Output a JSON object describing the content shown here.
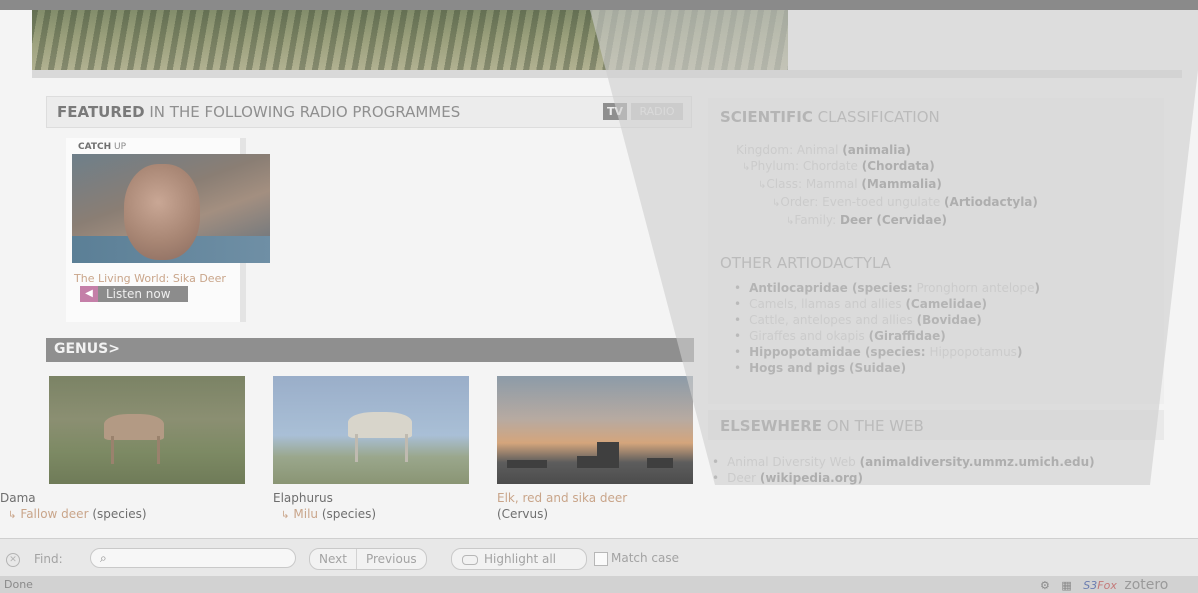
{
  "featured": {
    "title_bold": "FEATURED",
    "title_rest": " IN THE FOLLOWING RADIO PROGRAMMES",
    "tv_tab": "TV",
    "radio_tab": "RADIO"
  },
  "catchup": {
    "label_bold": "CATCH",
    "label_rest": " UP",
    "programme_title": "The Living World: Sika Deer",
    "listen_label": "Listen now"
  },
  "genus": {
    "title": "GENUS>",
    "items": [
      {
        "name": "Dama",
        "link": "Fallow deer",
        "suffix": "(species)"
      },
      {
        "name": "Elaphurus",
        "link": "Milu",
        "suffix": "(species)"
      },
      {
        "name": "Elk, red and sika deer",
        "suffix": "(Cervus)"
      }
    ]
  },
  "classification": {
    "title_bold": "SCIENTIFIC",
    "title_rest": " CLASSIFICATION",
    "kingdom_link": "Kingdom: Animal",
    "kingdom_rest": "(animalia)",
    "phylum_link": "Phylum: Chordate",
    "phylum_rest": "(Chordata)",
    "class_link": "Class: Mammal",
    "class_rest": "(Mammalia)",
    "order_link": "Order: Even-toed ungulate",
    "order_rest": "(Artiodactyla)",
    "family_link": "Family:",
    "family_rest": "Deer (Cervidae)"
  },
  "other": {
    "title": "OTHER ARTIODACTYLA",
    "items": [
      {
        "bold": "Antilocapridae (species:",
        "link": "Pronghorn antelope",
        "tail": ")"
      },
      {
        "link": "Camels, llamas and allies",
        "tail": "(Camelidae)"
      },
      {
        "link": "Cattle, antelopes and allies",
        "tail": "(Bovidae)"
      },
      {
        "link": "Giraffes and okapis",
        "tail": "(Giraffidae)"
      },
      {
        "bold": "Hippopotamidae (species:",
        "link": "Hippopotamus",
        "tail": ")"
      },
      {
        "bold": "Hogs and pigs",
        "tail": "(Suidae)"
      }
    ]
  },
  "elsewhere": {
    "title_bold": "ELSEWHERE",
    "title_rest": " ON THE WEB",
    "links": [
      {
        "link": "Animal Diversity Web",
        "tail": "(animaldiversity.ummz.umich.edu)"
      },
      {
        "link": "Deer",
        "tail": "(wikipedia.org)"
      }
    ]
  },
  "findbar": {
    "close_icon": "close-icon",
    "label": "Find:",
    "input_value": "",
    "next": "Next",
    "previous": "Previous",
    "highlight": "Highlight all",
    "match_case": "Match case"
  },
  "status": {
    "text": "Done",
    "s3_a": "S3",
    "s3_b": "Fox",
    "zotero": "zotero"
  },
  "colors": {
    "link": "#c9a58a",
    "overlay": "#cfcfcf"
  }
}
